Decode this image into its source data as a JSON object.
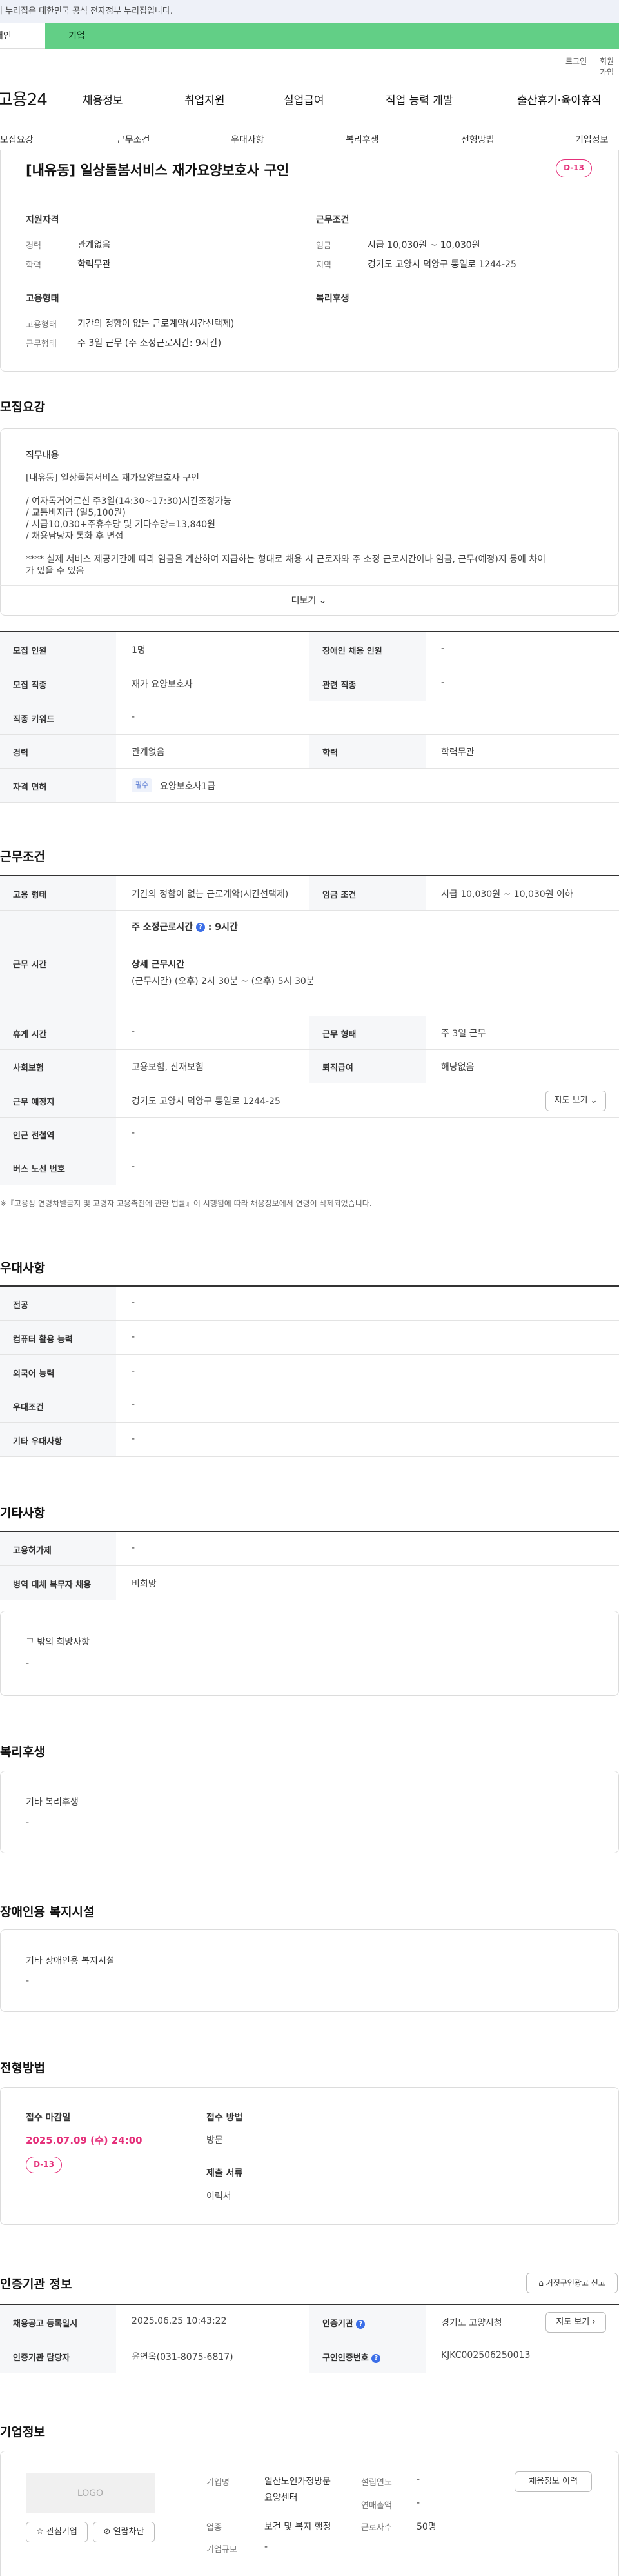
{
  "gov_banner": "이 누리집은 대한민국 공식 전자정부 누리집입니다.",
  "top_tabs": {
    "person": "개인",
    "company": "기업"
  },
  "util": {
    "login": "로그인",
    "join": "회원가입"
  },
  "logo": "고용24",
  "gnb": [
    "채용정보",
    "취업지원",
    "실업급여",
    "직업 능력 개발",
    "출산휴가·육아휴직"
  ],
  "subtabs": [
    "모집요강",
    "근무조건",
    "우대사항",
    "복리후생",
    "전형방법",
    "기업정보"
  ],
  "summary": {
    "title": "[내유동] 일상돌봄서비스 재가요양보호사 구인",
    "dday": "D-13",
    "qualification_head": "지원자격",
    "experience_label": "경력",
    "experience_value": "관계없음",
    "education_label": "학력",
    "education_value": "학력무관",
    "conditions_head": "근무조건",
    "wage_label": "임금",
    "wage_value": "시급 10,030원 ~ 10,030원",
    "region_label": "지역",
    "region_value": "경기도 고양시 덕양구 통일로 1244-25",
    "employment_head": "고용형태",
    "emp_type_label": "고용형태",
    "emp_type_value": "기간의 정함이 없는 근로계약(시간선택제)",
    "work_type_label": "근무형태",
    "work_type_value": "주 3일 근무 (주 소정근로시간: 9시간)",
    "welfare_head": "복리후생"
  },
  "recruit": {
    "section_title": "모집요강",
    "duty_label": "직무내용",
    "duty_lines": [
      "[내유동] 일상돌봄서비스 재가요양보호사 구인",
      "",
      "/ 여자독거어르신 주3일(14:30~17:30)시간조정가능",
      "/ 교통비지급 (일5,100원)",
      "/ 시급10,030+주휴수당 및 기타수당=13,840원",
      "/ 채용담당자 통화 후 면접",
      "",
      "**** 실제 서비스 제공기간에 따라 임금을 계산하여 지급하는 형태로 채용 시 근로자와 주 소정 근로시간이나 임금, 근무(예정)지 등에 차이",
      "가 있을 수 있음"
    ],
    "more": "더보기",
    "rows": [
      {
        "l1": "모집 인원",
        "v1": "1명",
        "l2": "장애인 채용 인원",
        "v2": "-"
      },
      {
        "l1": "모집 직종",
        "v1": "재가 요양보호사",
        "l2": "관련 직종",
        "v2": "-"
      },
      {
        "l1": "직종 키워드",
        "v1": "-"
      },
      {
        "l1": "경력",
        "v1": "관계없음",
        "l2": "학력",
        "v2": "학력무관"
      },
      {
        "l1": "자격 면허",
        "chip": "필수",
        "v1": "요양보호사1급"
      }
    ]
  },
  "conditions": {
    "section_title": "근무조건",
    "emp_type_label": "고용 형태",
    "emp_type_value": "기간의 정함이 없는 근로계약(시간선택제)",
    "wage_label": "임금 조건",
    "wage_value": "시급 10,030원 ~ 10,030원 이하",
    "work_time_label": "근무 시간",
    "weekly_hours": "주 소정근로시간",
    "weekly_hours_value": ": 9시간",
    "detail_head": "상세 근무시간",
    "detail_value": "(근무시간) (오후) 2시 30분 ~ (오후) 5시 30분",
    "break_label": "휴게 시간",
    "break_value": "-",
    "work_form_label": "근무 형태",
    "work_form_value": "주 3일 근무",
    "insurance_label": "사회보험",
    "insurance_value": "고용보험, 산재보험",
    "severance_label": "퇴직급여",
    "severance_value": "해당없음",
    "location_label": "근무 예정지",
    "location_value": "경기도 고양시 덕양구 통일로 1244-25",
    "map_btn": "지도 보기",
    "subway_label": "인근 전철역",
    "subway_value": "-",
    "bus_label": "버스 노선 번호",
    "bus_value": "-",
    "note": "※『고용상 연령차별금지 및 고령자 고용촉진에 관한 법률』이 시행됨에 따라 채용정보에서 연령이 삭제되었습니다."
  },
  "preference": {
    "section_title": "우대사항",
    "rows": [
      {
        "label": "전공",
        "value": "-"
      },
      {
        "label": "컴퓨터 활용 능력",
        "value": "-"
      },
      {
        "label": "외국어 능력",
        "value": "-"
      },
      {
        "label": "우대조건",
        "value": "-"
      },
      {
        "label": "기타 우대사항",
        "value": "-"
      }
    ]
  },
  "etc": {
    "section_title": "기타사항",
    "rows": [
      {
        "label": "고용허가제",
        "value": "-"
      },
      {
        "label": "병역 대체 복무자 채용",
        "value": "비희망"
      }
    ],
    "other_label": "그 밖의 희망사항",
    "other_value": "-"
  },
  "welfare": {
    "section_title": "복리후생",
    "label": "기타 복리후생",
    "value": "-"
  },
  "disabled": {
    "section_title": "장애인용 복지시설",
    "label": "기타 장애인용 복지시설",
    "value": "-"
  },
  "selection": {
    "section_title": "전형방법",
    "deadline_label": "접수 마감일",
    "deadline_value": "2025.07.09 (수) 24:00",
    "dday": "D-13",
    "method_label": "접수 방법",
    "method_value": "방문",
    "docs_label": "제출 서류",
    "docs_value": "이력서"
  },
  "agency": {
    "section_title": "인증기관 정보",
    "report_btn": "거짓구인광고 신고",
    "reg_label": "채용공고 등록일시",
    "reg_value": "2025.06.25 10:43:22",
    "agency_label": "인증기관",
    "agency_value": "경기도 고양시청",
    "map_btn": "지도 보기",
    "manager_label": "인증기관 담당자",
    "manager_value": "윤연옥(031-8075-6817)",
    "job_no_label": "구인인증번호",
    "job_no_value": "KJKC002506250013"
  },
  "company": {
    "section_title": "기업정보",
    "logo": "LOGO",
    "interest_btn": "관심기업",
    "block_btn": "열람차단",
    "name_label": "기업명",
    "name_value_1": "일산노인가정방문",
    "name_value_2": "요양센터",
    "industry_label": "업종",
    "industry_value": "보건 및 복지 행정",
    "size_label": "기업규모",
    "size_value": "-",
    "founded_label": "설립연도",
    "founded_value": "-",
    "sales_label": "연매출액",
    "sales_value": "-",
    "employees_label": "근로자수",
    "employees_value": "50명",
    "history_btn": "채용정보 이력"
  }
}
